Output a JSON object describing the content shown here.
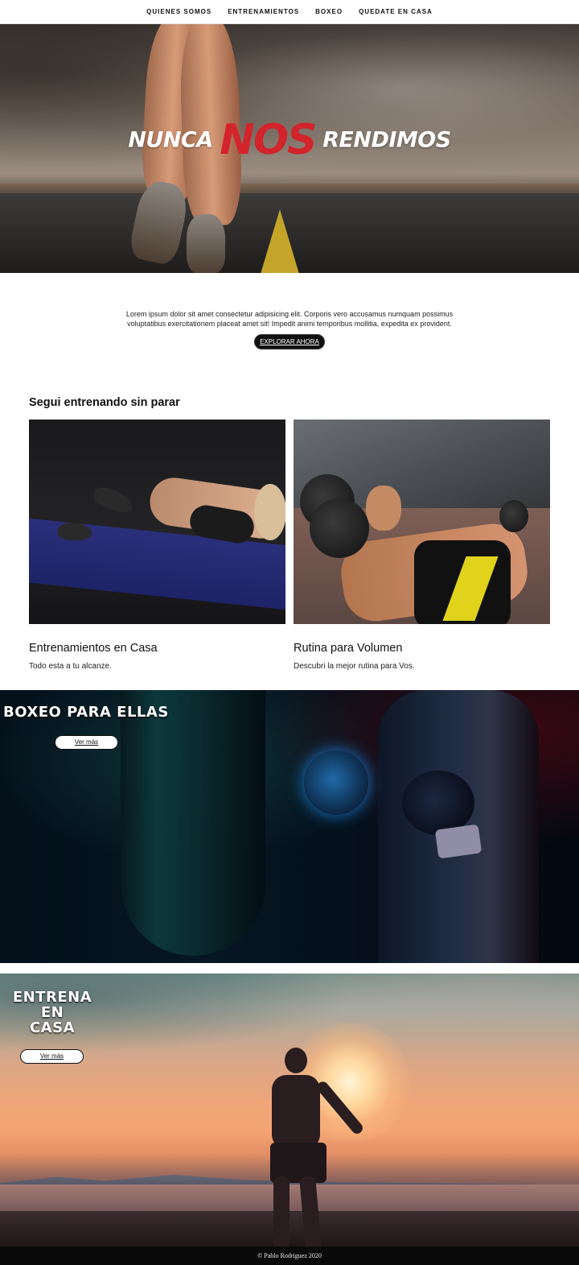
{
  "nav": {
    "items": [
      {
        "label": "QUIENES SOMOS"
      },
      {
        "label": "ENTRENAMIENTOS"
      },
      {
        "label": "BOXEO"
      },
      {
        "label": "QUEDATE EN CASA"
      }
    ]
  },
  "hero": {
    "title_left": "NUNCA",
    "title_accent": "NOS",
    "title_right": "RENDIMOS"
  },
  "intro": {
    "text": "Lorem ipsum dolor sit amet consectetur adipisicing elit. Corporis vero accusamus numquam possimus voluptatibus exercitationem placeat amet sit! Impedit animi temporibus mollitia, expedita ex provident.",
    "button_label": "EXPLORAR AHORA"
  },
  "section": {
    "title": "Segui entrenando sin parar",
    "cards": [
      {
        "title": "Entrenamientos en Casa",
        "subtitle": "Todo esta a tu alcanze."
      },
      {
        "title": "Rutina para Volumen",
        "subtitle": "Descubri la mejor rutina para Vos."
      }
    ]
  },
  "boxeo_banner": {
    "title": "BOXEO PARA ELLAS",
    "button_label": "Ver más"
  },
  "casa_banner": {
    "title_line1": "ENTRENA",
    "title_line2": "EN",
    "title_line3": "CASA",
    "button_label": "Ver más"
  },
  "footer": {
    "text": "© Pablo Rodriguez 2020"
  },
  "colors": {
    "accent": "#d3232b",
    "nav_bg": "#ffffff",
    "footer_bg": "#0a0a0a",
    "button_dark": "#111111"
  }
}
